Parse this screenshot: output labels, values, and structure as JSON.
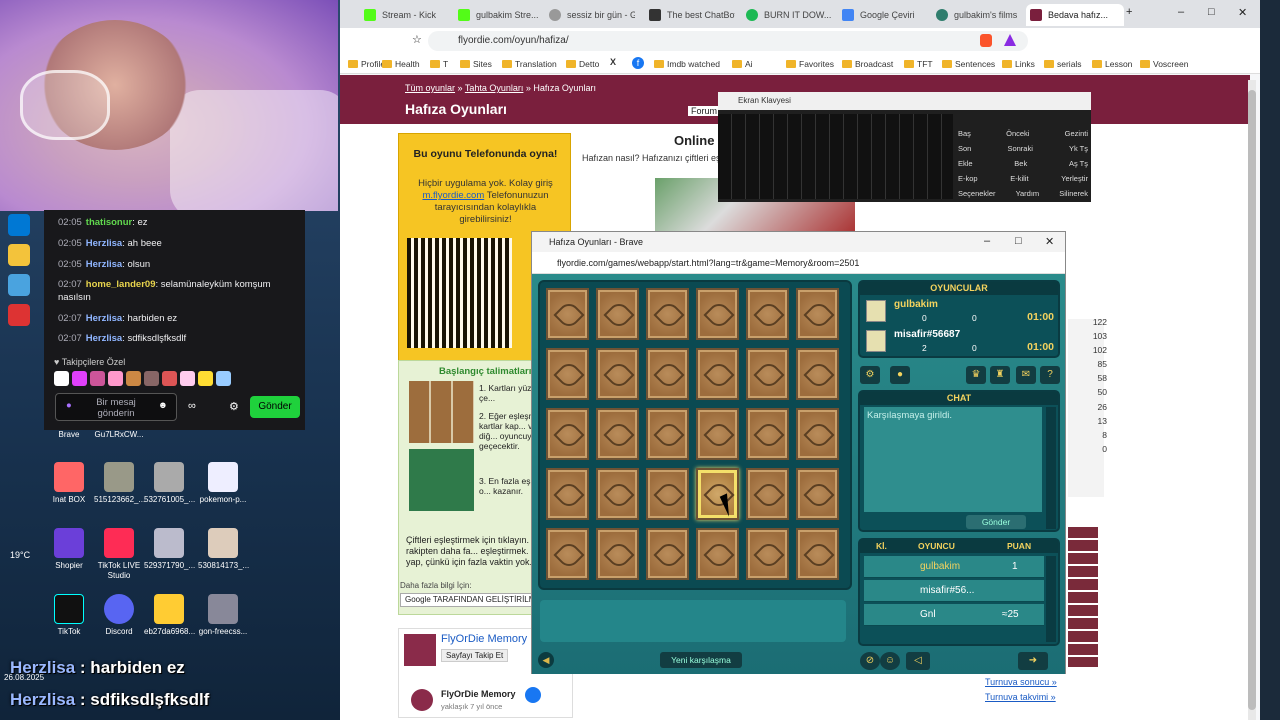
{
  "chat": {
    "messages": [
      {
        "time": "02:05",
        "user": "thatisonur",
        "text": "ez"
      },
      {
        "time": "02:05",
        "user": "Herzlisa",
        "text": "ah beee"
      },
      {
        "time": "02:05",
        "user": "Herzlisa",
        "text": "olsun"
      },
      {
        "time": "02:07",
        "user": "home_lander09",
        "text": "selamünaleyküm komşum nasılsın"
      },
      {
        "time": "02:07",
        "user": "Herzlisa",
        "text": "harbiden ez"
      },
      {
        "time": "02:07",
        "user": "Herzlisa",
        "text": "sdfiksdlşfksdlf"
      }
    ],
    "followers_label": "Takipçilere Özel",
    "input_placeholder": "Bir mesaj gönderin",
    "send_label": "Gönder"
  },
  "desktop": {
    "icons": [
      {
        "label": "Brave"
      },
      {
        "label": "Gu7LRxCW..."
      },
      {
        "label": "Inat BOX"
      },
      {
        "label": "515123662_..."
      },
      {
        "label": "532761005_..."
      },
      {
        "label": "pokemon-p..."
      },
      {
        "label": "Shopier"
      },
      {
        "label": "TikTok LIVE Studio"
      },
      {
        "label": "529371790_..."
      },
      {
        "label": "530814173_..."
      },
      {
        "label": "TikTok"
      },
      {
        "label": "Discord"
      },
      {
        "label": "eb27da6968..."
      },
      {
        "label": "gon-freecss..."
      }
    ],
    "weather": "19°C",
    "date": "26.08.2025"
  },
  "overlay": {
    "line1_user": "Herzlisa",
    "line1_text": " : harbiden ez",
    "line2_user": "Herzlisa",
    "line2_text": " : sdfiksdlşfksdlf"
  },
  "browser": {
    "tabs": [
      {
        "title": "Stream - Kick",
        "color": "#53fc18"
      },
      {
        "title": "gulbakim Stre...",
        "color": "#53fc18"
      },
      {
        "title": "sessiz bir gün - G...",
        "color": "#999"
      },
      {
        "title": "The best ChatBot...",
        "color": "#333"
      },
      {
        "title": "BURN IT DOW...",
        "color": "#1db954"
      },
      {
        "title": "Google Çeviri",
        "color": "#4285f4"
      },
      {
        "title": "gulbakim's films",
        "color": "#2f7d6d"
      },
      {
        "title": "Bedava hafız...",
        "color": "#7a1f3d"
      }
    ],
    "url": "flyordie.com/oyun/hafiza/",
    "bookmarks": [
      "Profile",
      "Health",
      "T",
      "Sites",
      "Translation",
      "Detto",
      "X",
      "f",
      "Imdb watched",
      "Ai",
      "Favorites",
      "Broadcast",
      "TFT",
      "Sentences",
      "Links",
      "serials",
      "Lesson",
      "Voscreen"
    ]
  },
  "page": {
    "crumb1": "Tüm oyunlar",
    "crumb2": "Tahta Oyunları",
    "crumb3": "Hafıza Oyunları",
    "title": "Hafıza Oyunları",
    "forum": "Forum",
    "phone_title": "Bu oyunu Telefonunda oyna!",
    "phone_desc_1": "Hiçbir uygulama yok. Kolay giriş ",
    "phone_link": "m.flyordie.com",
    "phone_desc_2": " Telefonunuzun tarayıcısından kolaylıkla girebilirsiniz!",
    "online": "Online",
    "hafiza_desc": "Hafızan nasıl? Hafızanızı çiftleri eş...",
    "instructions_title": "Başlangıç talimatları",
    "inst1": "1. Kartları yüzlerini çe...",
    "inst2": "2. Eğer eşleşmezl... kartlar kap... ve sıra diğ... oyuncuya geçecektir.",
    "inst3": "3. En fazla eşleştiren o... kazanır.",
    "desc": "Çiftleri eşleştirmek için tıklayın. Amaç rakipten daha fa... eşleştirmek. Çabuk yap, çünkü için fazla vaktin yok.",
    "more_info": "Daha fazla bilgi İçin:",
    "google": "Google TARAFINDAN GELİŞTİRİLMİŞ",
    "fb_title": "FlyOrDie Memory",
    "fb_follow": "Sayfayı Takip Et",
    "fb_post_title": "FlyOrDie Memory",
    "fb_post_time": "yaklaşık 7 yıl önce",
    "right_numbers": [
      "122",
      "103",
      "102",
      "85",
      "58",
      "50",
      "26",
      "13",
      "8",
      "0"
    ],
    "turnuva1": "Turnuva sonucu »",
    "turnuva2": "Turnuva takvimi »"
  },
  "keyboard": {
    "title": "Ekran Klavyesi",
    "side_rows": [
      [
        "Baş",
        "Önceki",
        "Gezinti"
      ],
      [
        "Son",
        "Sonraki",
        "Yk Tş"
      ],
      [
        "Ekle",
        "Bek",
        "Aş Tş"
      ],
      [
        "E-kop",
        "E-kilit",
        "Yerleştir"
      ],
      [
        "Seçenekler",
        "Yardım",
        "Silinerek"
      ]
    ]
  },
  "game": {
    "window_title": "Hafıza Oyunları - Brave",
    "url": "flyordie.com/games/webapp/start.html?lang=tr&game=Memory&room=2501",
    "players_header": "OYUNCULAR",
    "players": [
      {
        "name": "gulbakim",
        "s1": "0",
        "s2": "0",
        "time": "01:00"
      },
      {
        "name": "misafir#56687",
        "s1": "2",
        "s2": "0",
        "time": "01:00"
      }
    ],
    "chat_header": "CHAT",
    "chat_msg": "Karşılaşmaya girildi.",
    "chat_send": "Gönder",
    "score_headers": {
      "ki": "Kİ.",
      "player": "OYUNCU",
      "points": "PUAN"
    },
    "score_rows": [
      {
        "name": "gulbakim",
        "points": "1"
      },
      {
        "name": "misafir#56...",
        "points": ""
      },
      {
        "name": "Gnl",
        "points": "≈25"
      }
    ],
    "new_match": "Yeni karşılaşma",
    "highlight_card": {
      "row": 3,
      "col": 3
    }
  }
}
